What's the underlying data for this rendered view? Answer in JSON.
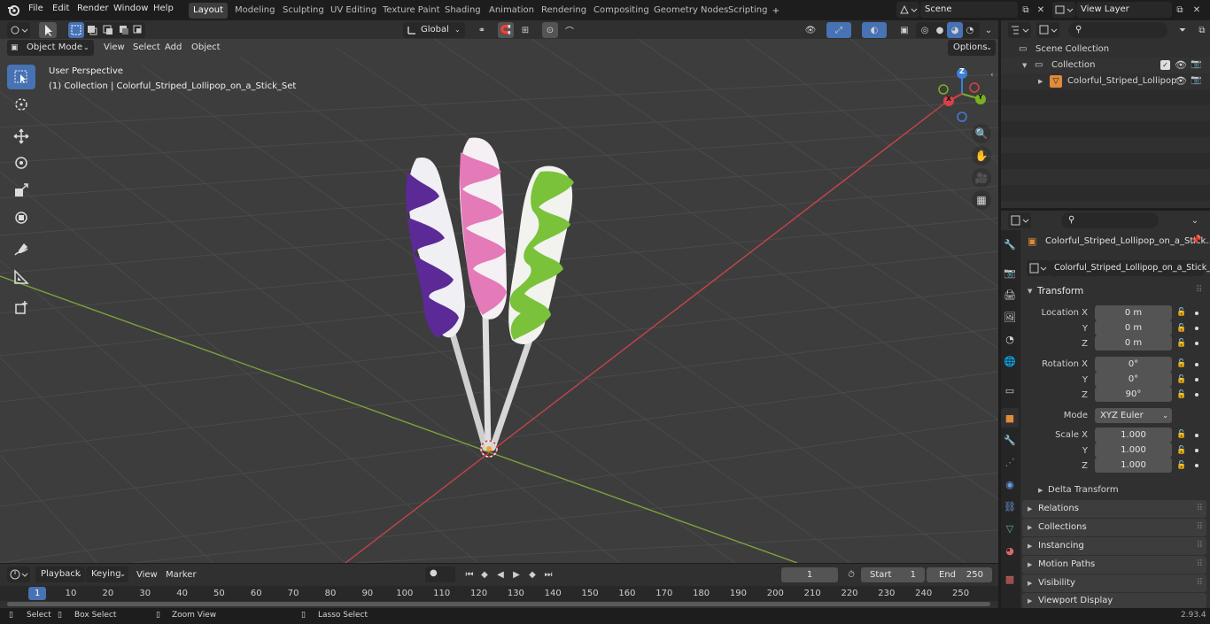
{
  "topbar": {
    "menus": [
      "File",
      "Edit",
      "Render",
      "Window",
      "Help"
    ],
    "workspaces": [
      "Layout",
      "Modeling",
      "Sculpting",
      "UV Editing",
      "Texture Paint",
      "Shading",
      "Animation",
      "Rendering",
      "Compositing",
      "Geometry Nodes",
      "Scripting"
    ],
    "active_workspace": "Layout",
    "scene": "Scene",
    "view_layer": "View Layer"
  },
  "viewport_header": {
    "mode": "Object Mode",
    "menus": [
      "View",
      "Select",
      "Add",
      "Object"
    ],
    "transform_orientation": "Global",
    "options": "Options"
  },
  "viewport": {
    "perspective": "User Perspective",
    "collection_info": "(1) Collection | Colorful_Striped_Lollipop_on_a_Stick_Set",
    "axis_labels": {
      "x": "X",
      "y": "Y",
      "z": "Z"
    }
  },
  "outliner": {
    "scene_collection": "Scene Collection",
    "collection": "Collection",
    "object": "Colorful_Striped_Lollipop"
  },
  "properties": {
    "object_name_header": "Colorful_Striped_Lollipop_on_a_Stick...",
    "object_name": "Colorful_Striped_Lollipop_on_a_Stick_Set",
    "transform_title": "Transform",
    "location_label": "Location X",
    "rotation_label": "Rotation X",
    "scale_label": "Scale X",
    "y_label": "Y",
    "z_label": "Z",
    "location": [
      "0 m",
      "0 m",
      "0 m"
    ],
    "rotation": [
      "0°",
      "0°",
      "90°"
    ],
    "mode_label": "Mode",
    "mode": "XYZ Euler",
    "scale": [
      "1.000",
      "1.000",
      "1.000"
    ],
    "delta_transform": "Delta Transform",
    "panels": [
      "Relations",
      "Collections",
      "Instancing",
      "Motion Paths",
      "Visibility",
      "Viewport Display"
    ]
  },
  "timeline": {
    "menus": [
      "Playback",
      "Keying",
      "View",
      "Marker"
    ],
    "current_frame": "1",
    "start_label": "Start",
    "start": "1",
    "end_label": "End",
    "end": "250",
    "ruler": [
      "1",
      "10",
      "20",
      "30",
      "40",
      "50",
      "60",
      "70",
      "80",
      "90",
      "100",
      "110",
      "120",
      "130",
      "140",
      "150",
      "160",
      "170",
      "180",
      "190",
      "200",
      "210",
      "220",
      "230",
      "240",
      "250"
    ]
  },
  "statusbar": {
    "select": "Select",
    "box_select": "Box Select",
    "zoom_view": "Zoom View",
    "lasso_select": "Lasso Select",
    "version": "2.93.4"
  },
  "colors": {
    "accent": "#4772b3",
    "x_axis": "#d8404a",
    "y_axis": "#7bb022",
    "z_axis": "#3d7fd8",
    "candy_purple": "#5b2a96",
    "candy_pink": "#e47ab8",
    "candy_green": "#7ac23a"
  }
}
